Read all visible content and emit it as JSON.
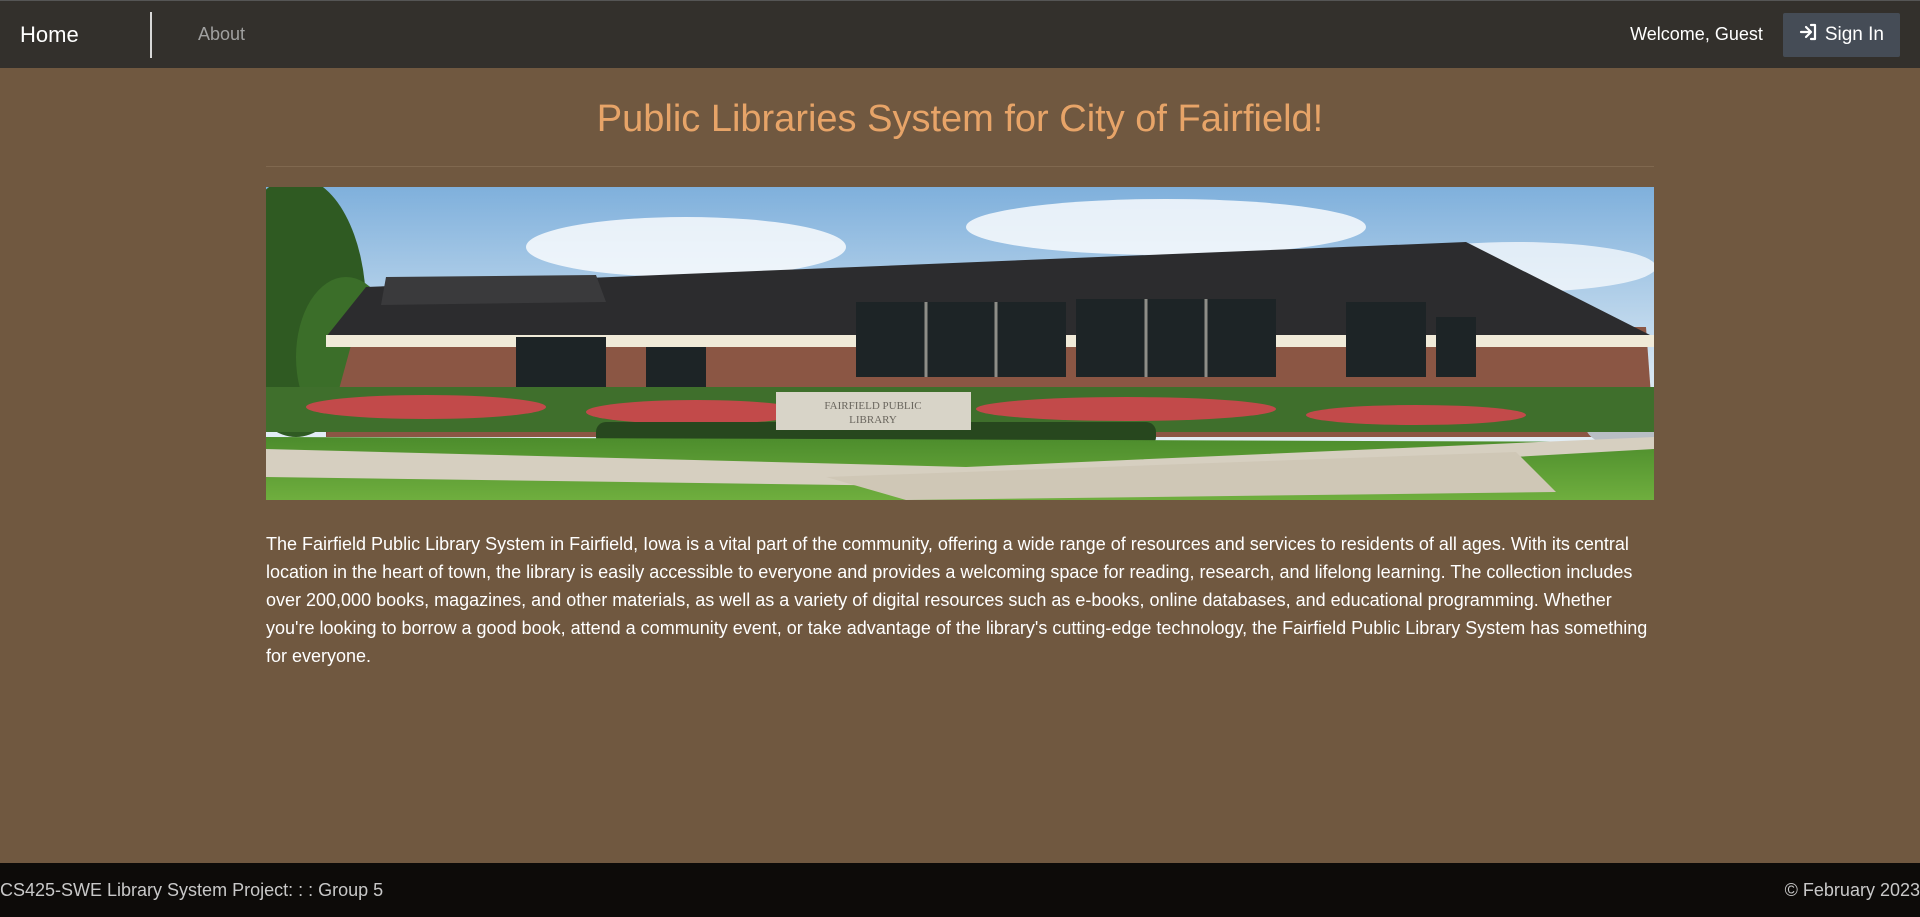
{
  "navbar": {
    "brand": "Home",
    "about": "About",
    "welcome": "Welcome, Guest",
    "signin": "Sign In",
    "signin_icon": "sign-in-icon"
  },
  "main": {
    "title": "Public Libraries System for City of Fairfield!",
    "hero_sign_text": "FAIRFIELD PUBLIC LIBRARY",
    "description": "The Fairfield Public Library System in Fairfield, Iowa is a vital part of the community, offering a wide range of resources and services to residents of all ages. With its central location in the heart of town, the library is easily accessible to everyone and provides a welcoming space for reading, research, and lifelong learning. The collection includes over 200,000 books, magazines, and other materials, as well as a variety of digital resources such as e-books, online databases, and educational programming. Whether you're looking to borrow a good book, attend a community event, or take advantage of the library's cutting-edge technology, the Fairfield Public Library System has something for everyone."
  },
  "footer": {
    "left": "CS425-SWE Library System Project: : : Group 5",
    "right": "© February 2023"
  },
  "colors": {
    "page_bg": "#705840",
    "navbar_bg": "#33302c",
    "title": "#e7a468",
    "footer_bg": "#0d0b09",
    "signin_bg": "#454c56"
  }
}
